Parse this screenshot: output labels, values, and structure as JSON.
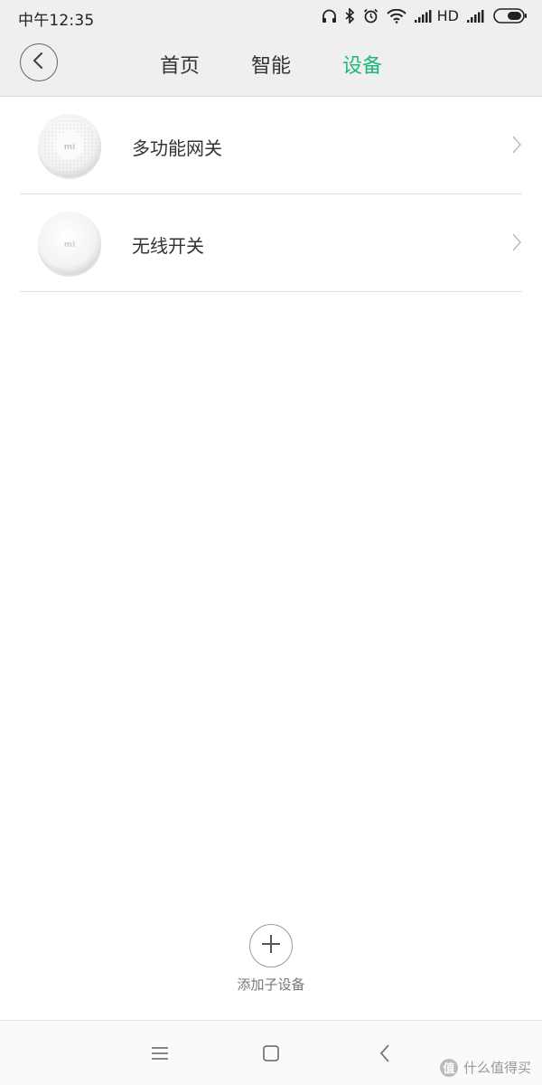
{
  "status_bar": {
    "time": "中午12:35",
    "network_label": "HD",
    "icons": [
      "headphones-icon",
      "bluetooth-icon",
      "alarm-icon",
      "wifi-icon",
      "signal-icon",
      "signal-icon",
      "battery-icon"
    ]
  },
  "header": {
    "back_icon": "chevron-left-icon",
    "tabs": [
      {
        "label": "首页",
        "active": false
      },
      {
        "label": "智能",
        "active": false
      },
      {
        "label": "设备",
        "active": true
      }
    ]
  },
  "devices": [
    {
      "name": "多功能网关",
      "icon": "gateway-device-image"
    },
    {
      "name": "无线开关",
      "icon": "wireless-switch-image"
    }
  ],
  "add_device": {
    "label": "添加子设备",
    "icon": "plus-icon"
  },
  "nav_bar": {
    "icons": [
      "menu-icon",
      "home-square-icon",
      "back-triangle-icon"
    ]
  },
  "watermark": {
    "badge": "值",
    "text": "什么值得买"
  },
  "colors": {
    "accent": "#1fb87a",
    "header_bg": "#efefef",
    "text": "#333333"
  }
}
